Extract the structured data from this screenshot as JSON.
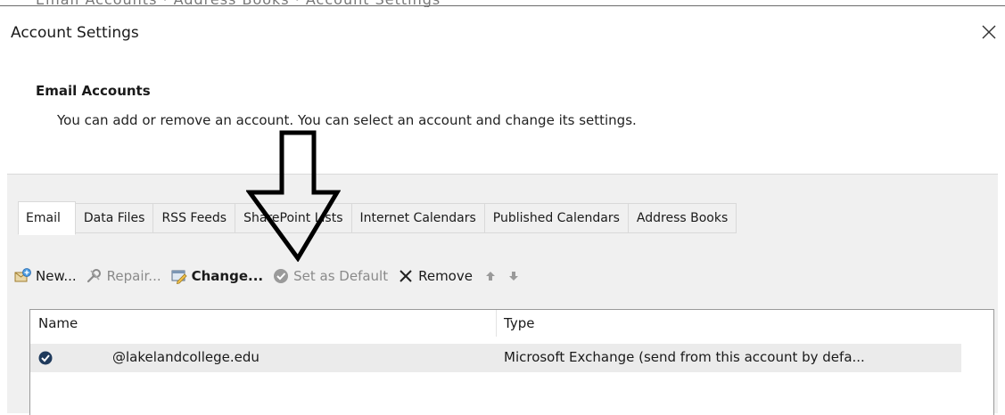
{
  "top_strip_text": "Email Accounts · Address Books · Account Settings",
  "dialog": {
    "title": "Account Settings",
    "close_glyph": "×"
  },
  "section": {
    "heading": "Email Accounts",
    "description": "You can add or remove an account. You can select an account and change its settings."
  },
  "tabs": [
    {
      "label": "Email",
      "active": true
    },
    {
      "label": "Data Files",
      "active": false
    },
    {
      "label": "RSS Feeds",
      "active": false
    },
    {
      "label": "SharePoint Lists",
      "active": false
    },
    {
      "label": "Internet Calendars",
      "active": false
    },
    {
      "label": "Published Calendars",
      "active": false
    },
    {
      "label": "Address Books",
      "active": false
    }
  ],
  "toolbar": {
    "new": {
      "label": "New...",
      "icon": "new-account-icon",
      "enabled": true
    },
    "repair": {
      "label": "Repair...",
      "icon": "wrench-icon",
      "enabled": false
    },
    "change": {
      "label": "Change...",
      "icon": "change-account-icon",
      "enabled": true
    },
    "set_default": {
      "label": "Set as Default",
      "icon": "check-circle-icon",
      "enabled": false
    },
    "remove": {
      "label": "Remove",
      "icon": "x-icon",
      "enabled": true
    },
    "move_up": {
      "icon": "arrow-up-icon",
      "enabled": false
    },
    "move_down": {
      "icon": "arrow-down-icon",
      "enabled": false
    }
  },
  "account_list": {
    "columns": [
      "Name",
      "Type"
    ],
    "rows": [
      {
        "name": "@lakelandcollege.edu",
        "type": "Microsoft Exchange (send from this account by defa...",
        "default": true
      }
    ]
  },
  "overlay": {
    "icon": "down-arrow-annotation"
  },
  "colors": {
    "panel_bg": "#f0f0f0",
    "selected_row_bg": "#ebebeb",
    "default_badge": "#1f3a5c",
    "disabled_text": "#8a8a8a"
  }
}
